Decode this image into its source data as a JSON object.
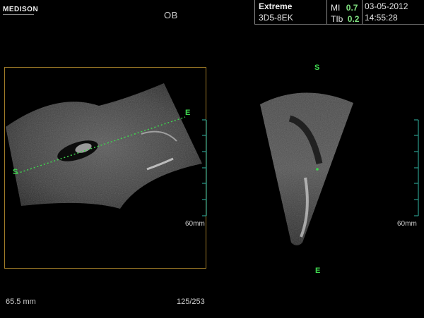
{
  "header": {
    "logo": "MEDISON",
    "mode": "OB",
    "preset": "Extreme",
    "probe": "3D5-8EK",
    "mi_label": "MI",
    "mi_value": "0.7",
    "tib_label": "TIb",
    "tib_value": "0.2",
    "date": "03-05-2012",
    "time": "14:55:28"
  },
  "left_view": {
    "start_marker": "S",
    "end_marker": "E",
    "depth_label": "60mm"
  },
  "right_view": {
    "top_marker": "S",
    "bottom_marker": "E",
    "depth_label": "60mm"
  },
  "footer": {
    "measurement": "65.5 mm",
    "frame_counter": "125/253"
  },
  "colors": {
    "marker_green": "#3fd64f",
    "scale_teal": "#2a9a8a",
    "frame_gold": "#a07c28"
  }
}
